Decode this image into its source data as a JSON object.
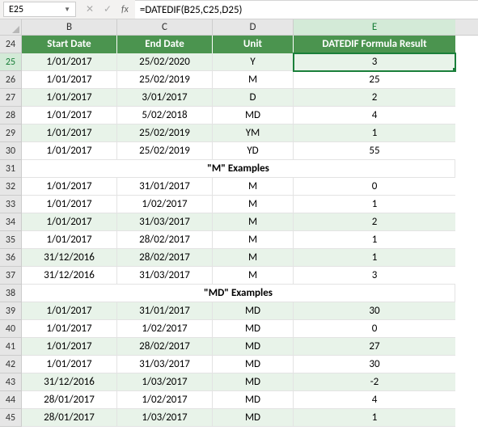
{
  "name_box": "E25",
  "formula": "=DATEDIF(B25,C25,D25)",
  "columns": [
    "B",
    "C",
    "D",
    "E"
  ],
  "headers": {
    "start_date": "Start Date",
    "end_date": "End Date",
    "unit": "Unit",
    "result": "DATEDIF Formula Result"
  },
  "sections": {
    "m_examples": "\"M\" Examples",
    "md_examples": "\"MD\" Examples"
  },
  "rows": [
    {
      "row": 24,
      "type": "header"
    },
    {
      "row": 25,
      "band": true,
      "b": "1/01/2017",
      "c": "25/02/2020",
      "d": "Y",
      "e": "3",
      "selected": true
    },
    {
      "row": 26,
      "band": false,
      "b": "1/01/2017",
      "c": "25/02/2019",
      "d": "M",
      "e": "25"
    },
    {
      "row": 27,
      "band": true,
      "b": "1/01/2017",
      "c": "3/01/2017",
      "d": "D",
      "e": "2"
    },
    {
      "row": 28,
      "band": false,
      "b": "1/01/2017",
      "c": "5/02/2018",
      "d": "MD",
      "e": "4"
    },
    {
      "row": 29,
      "band": true,
      "b": "1/01/2017",
      "c": "25/02/2019",
      "d": "YM",
      "e": "1"
    },
    {
      "row": 30,
      "band": false,
      "b": "1/01/2017",
      "c": "25/02/2019",
      "d": "YD",
      "e": "55"
    },
    {
      "row": 31,
      "type": "section",
      "label": "m_examples"
    },
    {
      "row": 32,
      "band": false,
      "b": "1/01/2017",
      "c": "31/01/2017",
      "d": "M",
      "e": "0"
    },
    {
      "row": 33,
      "band": false,
      "b": "1/01/2017",
      "c": "1/02/2017",
      "d": "M",
      "e": "1"
    },
    {
      "row": 34,
      "band": true,
      "b": "1/01/2017",
      "c": "31/03/2017",
      "d": "M",
      "e": "2"
    },
    {
      "row": 35,
      "band": false,
      "b": "1/01/2017",
      "c": "28/02/2017",
      "d": "M",
      "e": "1"
    },
    {
      "row": 36,
      "band": true,
      "b": "31/12/2016",
      "c": "28/02/2017",
      "d": "M",
      "e": "1"
    },
    {
      "row": 37,
      "band": false,
      "b": "31/12/2016",
      "c": "31/03/2017",
      "d": "M",
      "e": "3"
    },
    {
      "row": 38,
      "type": "section",
      "label": "md_examples"
    },
    {
      "row": 39,
      "band": true,
      "b": "1/01/2017",
      "c": "31/01/2017",
      "d": "MD",
      "e": "30"
    },
    {
      "row": 40,
      "band": false,
      "b": "1/01/2017",
      "c": "1/02/2017",
      "d": "MD",
      "e": "0"
    },
    {
      "row": 41,
      "band": true,
      "b": "1/01/2017",
      "c": "28/02/2017",
      "d": "MD",
      "e": "27"
    },
    {
      "row": 42,
      "band": false,
      "b": "1/01/2017",
      "c": "31/03/2017",
      "d": "MD",
      "e": "30"
    },
    {
      "row": 43,
      "band": true,
      "b": "31/12/2016",
      "c": "1/03/2017",
      "d": "MD",
      "e": "-2"
    },
    {
      "row": 44,
      "band": false,
      "b": "28/01/2017",
      "c": "1/02/2017",
      "d": "MD",
      "e": "4"
    },
    {
      "row": 45,
      "band": true,
      "b": "28/01/2017",
      "c": "1/03/2017",
      "d": "MD",
      "e": "1"
    }
  ]
}
